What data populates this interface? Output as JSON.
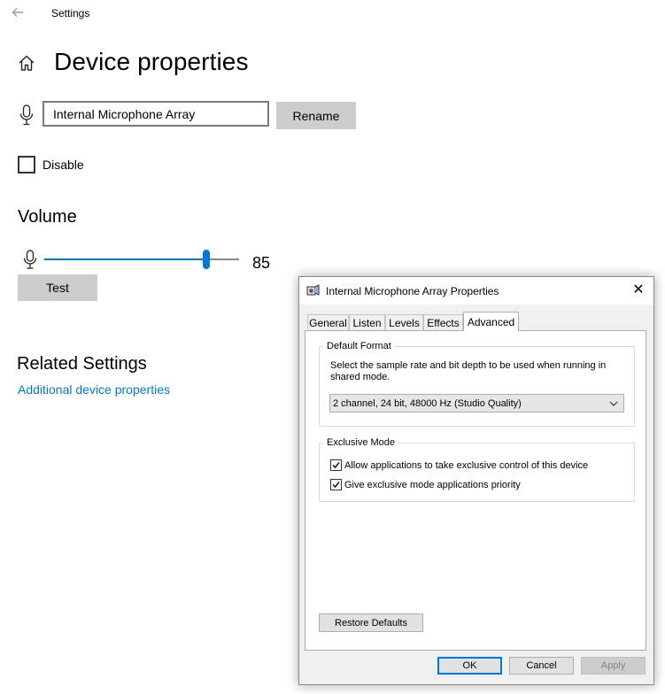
{
  "settings": {
    "app_title": "Settings",
    "page_title": "Device properties",
    "device_name_value": "Internal Microphone Array",
    "rename_label": "Rename",
    "disable_label": "Disable",
    "volume_heading": "Volume",
    "volume_value": "85",
    "volume_level": 85,
    "test_label": "Test",
    "related_heading": "Related Settings",
    "related_link": "Additional device properties",
    "accent_color": "#0078d7",
    "icons": [
      "back-arrow-icon",
      "home-icon",
      "microphone-icon"
    ]
  },
  "dialog": {
    "title": "Internal Microphone Array Properties",
    "close_glyph": "✕",
    "tabs": [
      {
        "label": "General",
        "active": false
      },
      {
        "label": "Listen",
        "active": false
      },
      {
        "label": "Levels",
        "active": false
      },
      {
        "label": "Effects",
        "active": false
      },
      {
        "label": "Advanced",
        "active": true
      }
    ],
    "default_format": {
      "label": "Default Format",
      "description": "Select the sample rate and bit depth to be used when running in shared mode.",
      "selected": "2 channel, 24 bit, 48000 Hz (Studio Quality)"
    },
    "exclusive_mode": {
      "label": "Exclusive Mode",
      "options": [
        {
          "label": "Allow applications to take exclusive control of this device",
          "checked": true
        },
        {
          "label": "Give exclusive mode applications priority",
          "checked": true
        }
      ]
    },
    "restore_label": "Restore Defaults",
    "buttons": {
      "ok": "OK",
      "cancel": "Cancel",
      "apply": "Apply"
    }
  }
}
